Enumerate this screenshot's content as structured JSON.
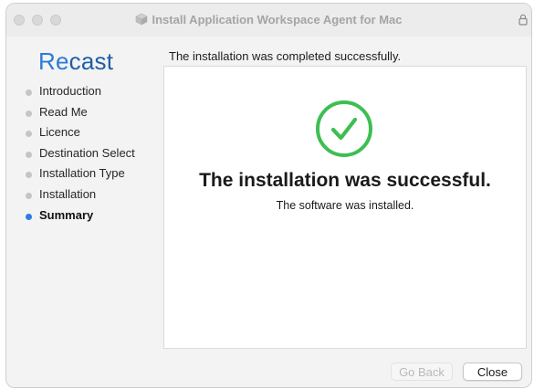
{
  "window": {
    "title": "Install Application Workspace Agent for Mac"
  },
  "brand": {
    "prefix": "Re",
    "rest": "cast"
  },
  "sidebar": {
    "steps": [
      {
        "label": "Introduction",
        "active": false
      },
      {
        "label": "Read Me",
        "active": false
      },
      {
        "label": "Licence",
        "active": false
      },
      {
        "label": "Destination Select",
        "active": false
      },
      {
        "label": "Installation Type",
        "active": false
      },
      {
        "label": "Installation",
        "active": false
      },
      {
        "label": "Summary",
        "active": true
      }
    ]
  },
  "main": {
    "header": "The installation was completed successfully.",
    "result_title": "The installation was successful.",
    "result_subtitle": "The software was installed."
  },
  "buttons": {
    "back_label": "Go Back",
    "close_label": "Close"
  },
  "colors": {
    "accent": "#2f7be6",
    "success": "#3ebe52",
    "brand": "#1f5ea8"
  },
  "icons": {
    "title_icon": "package-icon",
    "lock": "lock-icon",
    "result": "checkmark-circle-icon"
  }
}
